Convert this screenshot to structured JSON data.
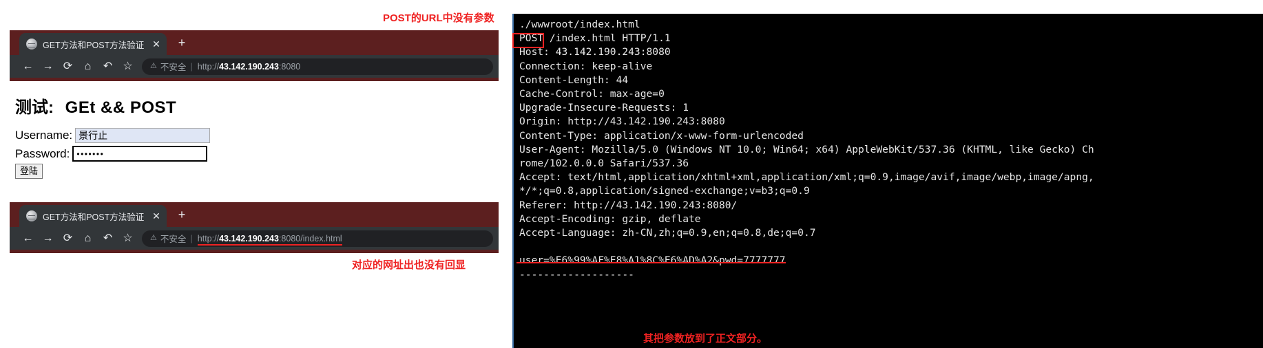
{
  "annotations": {
    "top": "POST的URL中没有参数",
    "bottom_left": "对应的网址出也没有回显",
    "bottom_terminal": "其把参数放到了正文部分。"
  },
  "browser1": {
    "tab": {
      "title": "GET方法和POST方法验证",
      "close_label": "✕",
      "favicon_name": "globe-favicon"
    },
    "newtab_label": "+",
    "toolbar": {
      "back": "←",
      "forward": "→",
      "reload": "⟳",
      "home": "⌂",
      "undo": "↶",
      "bookmark": "☆"
    },
    "omnibox": {
      "warn_icon": "⚠",
      "security_text": "不安全",
      "separator": "|",
      "url_scheme": "http://",
      "url_host": "43.142.190.243",
      "url_port": ":8080",
      "url_path": ""
    }
  },
  "browser2": {
    "tab": {
      "title": "GET方法和POST方法验证",
      "close_label": "✕",
      "favicon_name": "globe-favicon"
    },
    "newtab_label": "+",
    "toolbar": {
      "back": "←",
      "forward": "→",
      "reload": "⟳",
      "home": "⌂",
      "undo": "↶",
      "bookmark": "☆"
    },
    "omnibox": {
      "warn_icon": "⚠",
      "security_text": "不安全",
      "separator": "|",
      "url_scheme": "http://",
      "url_host": "43.142.190.243",
      "url_port": ":8080",
      "url_path": "/index.html"
    }
  },
  "page": {
    "heading_cn": "测试:",
    "heading_en": "GEt && POST",
    "username_label": "Username:",
    "username_value": "景行止",
    "password_label": "Password:",
    "password_value": "•••••••",
    "login_button": "登陆"
  },
  "terminal": {
    "lines": [
      "./wwwroot/index.html",
      "POST /index.html HTTP/1.1",
      "Host: 43.142.190.243:8080",
      "Connection: keep-alive",
      "Content-Length: 44",
      "Cache-Control: max-age=0",
      "Upgrade-Insecure-Requests: 1",
      "Origin: http://43.142.190.243:8080",
      "Content-Type: application/x-www-form-urlencoded",
      "User-Agent: Mozilla/5.0 (Windows NT 10.0; Win64; x64) AppleWebKit/537.36 (KHTML, like Gecko) Ch",
      "rome/102.0.0.0 Safari/537.36",
      "Accept: text/html,application/xhtml+xml,application/xml;q=0.9,image/avif,image/webp,image/apng,",
      "*/*;q=0.8,application/signed-exchange;v=b3;q=0.9",
      "Referer: http://43.142.190.243:8080/",
      "Accept-Encoding: gzip, deflate",
      "Accept-Language: zh-CN,zh;q=0.9,en;q=0.8,de;q=0.7",
      "",
      "user=%E6%99%AF%E8%A1%8C%E6%AD%A2&pwd=7777777",
      "-------------------"
    ]
  },
  "colors": {
    "accent_red": "#ef2222",
    "chrome_frame": "#5c1f1f",
    "chrome_toolbar": "#323639",
    "omnibox_bg": "#202124",
    "terminal_bg": "#000000",
    "terminal_border": "#3a6ea5"
  }
}
